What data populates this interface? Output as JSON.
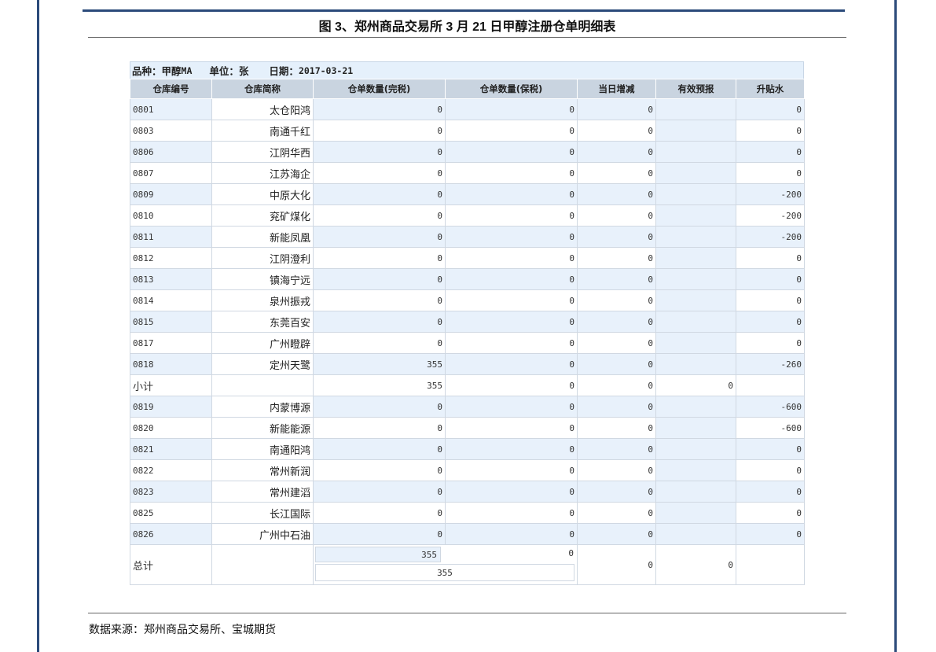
{
  "figure_title": "图 3、郑州商品交易所 3 月 21 日甲醇注册仓单明细表",
  "source": "数据来源：郑州商品交易所、宝城期货",
  "meta": {
    "variety_label": "品种：",
    "variety_value": "甲醇MA",
    "unit_label": "单位：",
    "unit_value": "张",
    "date_label": "日期：",
    "date_value": "2017-03-21"
  },
  "columns": [
    "仓库编号",
    "仓库简称",
    "仓单数量(完税)",
    "仓单数量(保税)",
    "当日增减",
    "有效预报",
    "升贴水"
  ],
  "rows": [
    {
      "code": "0801",
      "name": "太仓阳鸿",
      "wanshui": "0",
      "baoshui": "0",
      "change": "0",
      "forecast": "",
      "premium": "0"
    },
    {
      "code": "0803",
      "name": "南通千红",
      "wanshui": "0",
      "baoshui": "0",
      "change": "0",
      "forecast": "",
      "premium": "0"
    },
    {
      "code": "0806",
      "name": "江阴华西",
      "wanshui": "0",
      "baoshui": "0",
      "change": "0",
      "forecast": "",
      "premium": "0"
    },
    {
      "code": "0807",
      "name": "江苏海企",
      "wanshui": "0",
      "baoshui": "0",
      "change": "0",
      "forecast": "",
      "premium": "0"
    },
    {
      "code": "0809",
      "name": "中原大化",
      "wanshui": "0",
      "baoshui": "0",
      "change": "0",
      "forecast": "",
      "premium": "-200"
    },
    {
      "code": "0810",
      "name": "兖矿煤化",
      "wanshui": "0",
      "baoshui": "0",
      "change": "0",
      "forecast": "",
      "premium": "-200"
    },
    {
      "code": "0811",
      "name": "新能凤凰",
      "wanshui": "0",
      "baoshui": "0",
      "change": "0",
      "forecast": "",
      "premium": "-200"
    },
    {
      "code": "0812",
      "name": "江阴澄利",
      "wanshui": "0",
      "baoshui": "0",
      "change": "0",
      "forecast": "",
      "premium": "0"
    },
    {
      "code": "0813",
      "name": "镇海宁远",
      "wanshui": "0",
      "baoshui": "0",
      "change": "0",
      "forecast": "",
      "premium": "0"
    },
    {
      "code": "0814",
      "name": "泉州振戎",
      "wanshui": "0",
      "baoshui": "0",
      "change": "0",
      "forecast": "",
      "premium": "0"
    },
    {
      "code": "0815",
      "name": "东莞百安",
      "wanshui": "0",
      "baoshui": "0",
      "change": "0",
      "forecast": "",
      "premium": "0"
    },
    {
      "code": "0817",
      "name": "广州瞪辟",
      "wanshui": "0",
      "baoshui": "0",
      "change": "0",
      "forecast": "",
      "premium": "0"
    },
    {
      "code": "0818",
      "name": "定州天鹭",
      "wanshui": "355",
      "baoshui": "0",
      "change": "0",
      "forecast": "",
      "premium": "-260"
    }
  ],
  "subtotal": {
    "label": "小计",
    "name": "",
    "wanshui": "355",
    "baoshui": "0",
    "change": "0",
    "forecast": "0",
    "premium": ""
  },
  "rows2": [
    {
      "code": "0819",
      "name": "内蒙博源",
      "wanshui": "0",
      "baoshui": "0",
      "change": "0",
      "forecast": "",
      "premium": "-600"
    },
    {
      "code": "0820",
      "name": "新能能源",
      "wanshui": "0",
      "baoshui": "0",
      "change": "0",
      "forecast": "",
      "premium": "-600"
    },
    {
      "code": "0821",
      "name": "南通阳鸿",
      "wanshui": "0",
      "baoshui": "0",
      "change": "0",
      "forecast": "",
      "premium": "0"
    },
    {
      "code": "0822",
      "name": "常州新润",
      "wanshui": "0",
      "baoshui": "0",
      "change": "0",
      "forecast": "",
      "premium": "0"
    },
    {
      "code": "0823",
      "name": "常州建滔",
      "wanshui": "0",
      "baoshui": "0",
      "change": "0",
      "forecast": "",
      "premium": "0"
    },
    {
      "code": "0825",
      "name": "长江国际",
      "wanshui": "0",
      "baoshui": "0",
      "change": "0",
      "forecast": "",
      "premium": "0"
    },
    {
      "code": "0826",
      "name": "广州中石油",
      "wanshui": "0",
      "baoshui": "0",
      "change": "0",
      "forecast": "",
      "premium": "0"
    }
  ],
  "total": {
    "label": "总计",
    "wanshui": "355",
    "baoshui": "0",
    "combined": "355",
    "change": "0",
    "forecast": "0",
    "premium": ""
  }
}
